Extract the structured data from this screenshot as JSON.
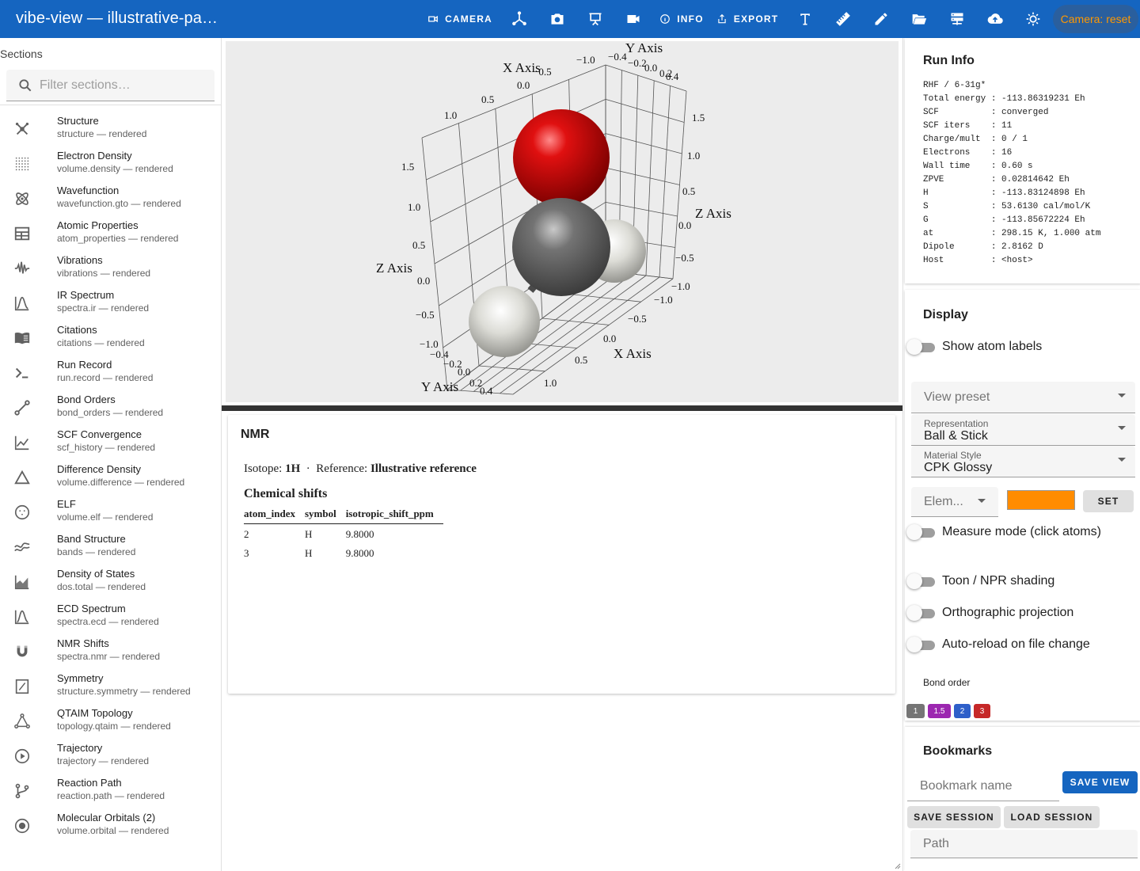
{
  "app": {
    "title": "vibe-view — illustrative-panels"
  },
  "toolbar": {
    "camera_label": "CAMERA",
    "info_label": "INFO",
    "export_label": "EXPORT",
    "camera_reset_label": "Camera: reset"
  },
  "sidebar": {
    "title": "Sections",
    "filter_placeholder": "Filter sections…",
    "items": [
      {
        "name": "Structure",
        "sub": "structure — rendered",
        "icon": "structure-icon"
      },
      {
        "name": "Electron Density",
        "sub": "volume.density — rendered",
        "icon": "grid-dots-icon"
      },
      {
        "name": "Wavefunction",
        "sub": "wavefunction.gto — rendered",
        "icon": "atom-icon"
      },
      {
        "name": "Atomic Properties",
        "sub": "atom_properties — rendered",
        "icon": "table-icon"
      },
      {
        "name": "Vibrations",
        "sub": "vibrations — rendered",
        "icon": "waveform-icon"
      },
      {
        "name": "IR Spectrum",
        "sub": "spectra.ir — rendered",
        "icon": "spectrum-icon"
      },
      {
        "name": "Citations",
        "sub": "citations — rendered",
        "icon": "book-icon"
      },
      {
        "name": "Run Record",
        "sub": "run.record — rendered",
        "icon": "terminal-icon"
      },
      {
        "name": "Bond Orders",
        "sub": "bond_orders — rendered",
        "icon": "bond-icon"
      },
      {
        "name": "SCF Convergence",
        "sub": "scf_history — rendered",
        "icon": "line-chart-icon"
      },
      {
        "name": "Difference Density",
        "sub": "volume.difference — rendered",
        "icon": "triangle-icon"
      },
      {
        "name": "ELF",
        "sub": "volume.elf — rendered",
        "icon": "dotted-circle-icon"
      },
      {
        "name": "Band Structure",
        "sub": "bands — rendered",
        "icon": "bands-icon"
      },
      {
        "name": "Density of States",
        "sub": "dos.total — rendered",
        "icon": "area-chart-icon"
      },
      {
        "name": "ECD Spectrum",
        "sub": "spectra.ecd — rendered",
        "icon": "spectrum-icon"
      },
      {
        "name": "NMR Shifts",
        "sub": "spectra.nmr — rendered",
        "icon": "magnet-icon"
      },
      {
        "name": "Symmetry",
        "sub": "structure.symmetry — rendered",
        "icon": "symmetry-icon"
      },
      {
        "name": "QTAIM Topology",
        "sub": "topology.qtaim — rendered",
        "icon": "topology-icon"
      },
      {
        "name": "Trajectory",
        "sub": "trajectory — rendered",
        "icon": "play-circle-icon"
      },
      {
        "name": "Reaction Path",
        "sub": "reaction.path — rendered",
        "icon": "branch-icon"
      },
      {
        "name": "Molecular Orbitals (2)",
        "sub": "volume.orbital — rendered",
        "icon": "orbital-icon"
      }
    ]
  },
  "viewport": {
    "axis_titles": {
      "x": "X Axis",
      "y": "Y Axis",
      "z": "Z Axis"
    },
    "ticks": {
      "x_top": [
        "−1.0",
        "−0.5",
        "0.0",
        "0.5",
        "1.0"
      ],
      "y_top": [
        "−0.4",
        "−0.2",
        "0.0",
        "0.2",
        "0.4"
      ],
      "z_right": [
        "1.5",
        "1.0",
        "0.5",
        "0.0",
        "−0.5",
        "−1.0"
      ],
      "z_left": [
        "1.5",
        "1.0",
        "0.5",
        "0.0",
        "−0.5",
        "−1.0"
      ],
      "x_bottom": [
        "−1.0",
        "−0.5",
        "0.0",
        "0.5",
        "1.0"
      ],
      "y_bottom": [
        "−0.4",
        "−0.2",
        "0.0",
        "0.2",
        "0.4"
      ]
    },
    "atoms": [
      {
        "element": "O",
        "color": "#d40000"
      },
      {
        "element": "C",
        "color": "#606060"
      },
      {
        "element": "H",
        "color": "#e6e6e2"
      },
      {
        "element": "H",
        "color": "#e6e6e2"
      }
    ]
  },
  "nmr": {
    "title": "NMR",
    "isotope_label": "Isotope:",
    "isotope": "1H",
    "separator": "·",
    "reference_label": "Reference:",
    "reference": "Illustrative reference",
    "shifts_heading": "Chemical shifts",
    "columns": [
      "atom_index",
      "symbol",
      "isotropic_shift_ppm"
    ],
    "rows": [
      [
        "2",
        "H",
        "9.8000"
      ],
      [
        "3",
        "H",
        "9.8000"
      ]
    ]
  },
  "run_info": {
    "title": "Run Info",
    "lines": [
      "RHF / 6-31g*",
      "Total energy : -113.86319231 Eh",
      "SCF          : converged",
      "SCF iters    : 11",
      "Charge/mult  : 0 / 1",
      "Electrons    : 16",
      "Wall time    : 0.60 s",
      "ZPVE         : 0.02814642 Eh",
      "H            : -113.83124898 Eh",
      "S            : 53.6130 cal/mol/K",
      "G            : -113.85672224 Eh",
      "at           : 298.15 K, 1.000 atm",
      "Dipole       : 2.8162 D",
      "Host         : <host>"
    ]
  },
  "display": {
    "title": "Display",
    "show_atom_labels": "Show atom labels",
    "view_preset_placeholder": "View preset",
    "representation_label": "Representation",
    "representation_value": "Ball & Stick",
    "material_label": "Material Style",
    "material_value": "CPK Glossy",
    "element_placeholder": "Elem...",
    "element_color": "#ff8c00",
    "set_label": "SET",
    "measure_mode": "Measure mode (click atoms)",
    "toon_shading": "Toon / NPR shading",
    "ortho": "Orthographic projection",
    "auto_reload": "Auto-reload on file change",
    "bond_order_label": "Bond order",
    "bond_orders": [
      {
        "label": "1",
        "color": "#757575"
      },
      {
        "label": "1.5",
        "color": "#9c27b0"
      },
      {
        "label": "2",
        "color": "#2e5fc9"
      },
      {
        "label": "3",
        "color": "#c62828"
      }
    ]
  },
  "bookmarks": {
    "title": "Bookmarks",
    "name_placeholder": "Bookmark name",
    "save_view": "SAVE VIEW",
    "save_session": "SAVE SESSION",
    "load_session": "LOAD SESSION",
    "path_placeholder": "Path"
  }
}
